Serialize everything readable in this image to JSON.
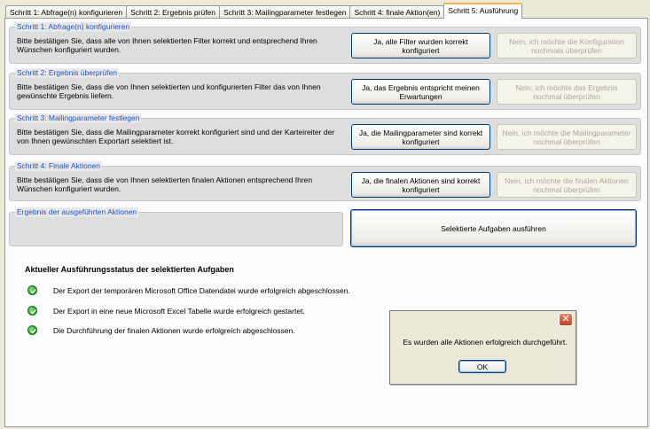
{
  "tabs": [
    {
      "label": "Schritt 1: Abfrage(n) konfigurieren"
    },
    {
      "label": "Schritt 2: Ergebnis prüfen"
    },
    {
      "label": "Schritt 3: Mailingparameter festlegen"
    },
    {
      "label": "Schritt 4: finale Aktion(en)"
    },
    {
      "label": "Schritt 5: Ausführung",
      "active": true
    }
  ],
  "sections": [
    {
      "title": "Schritt 1: Abfrage(n) konfigurieren",
      "text": "Bitte bestätigen Sie, dass alle von Ihnen selektierten Filter korrekt und entsprechend Ihren Wünschen konfiguriert wurden.",
      "yes_label": "Ja, alle Filter wurden korrekt konfiguriert",
      "no_label": "Nein, ich möchte die Konfiguration nochmals überprüfen"
    },
    {
      "title": "Schritt 2: Ergebnis überprüfen",
      "text": "Bitte bestätigen Sie, dass die von Ihnen selektierten und konfigurierten Filter das von Ihnen gewünschte Ergebnis liefern.",
      "yes_label": "Ja, das Ergebnis entspricht meinen Erwartungen",
      "no_label": "Nein, ich möchte das Ergebnis nochmal überprüfen"
    },
    {
      "title": "Schritt 3: Mailingparameter festlegen",
      "text": "Bitte bestätigen Sie, dass die Mailingparameter korrekt konfiguriert sind und der Karteireiter der von Ihnen gewünschten Exportart selektiert ist.",
      "yes_label": "Ja, die Mailingparameter sind korrekt konfiguriert",
      "no_label": "Nein, ich möchte die Mailingparameter nochmal überprüfen"
    },
    {
      "title": "Schritt 4: Finale Aktionen",
      "text": "Bitte bestätigen Sie, dass die von Ihnen selektierten finalen Aktionen entsprechend Ihren Wünschen konfiguriert wurden.",
      "yes_label": "Ja, die finalen Aktionen sind korrekt konfiguriert",
      "no_label": "Nein, ich möchte die finalen Aktionen nochmal überprüfen"
    }
  ],
  "results": {
    "title": "Ergebnis der ausgeführten Aktionen",
    "execute_label": "Selektierte Aufgaben ausführen"
  },
  "status": {
    "heading": "Aktueller Ausführungsstatus der selektierten Aufgaben",
    "lines": [
      "Der Export der temporären Microsoft Office Datendatei wurde erfolgreich abgeschlossen.",
      "Der Export in eine neue Microsoft Excel Tabelle wurde erfolgreich gestartet.",
      "Die Durchführung der finalen Aktionen wurde erfolgreich abgeschlossen."
    ]
  },
  "dialog": {
    "message": "Es wurden alle Aktionen erfolgreich durchgeführt.",
    "ok_label": "OK",
    "close_glyph": "✕"
  },
  "colors": {
    "section_title": "#1f50c8",
    "active_tab_accent": "#f7b249",
    "success": "#1c9a1c"
  }
}
